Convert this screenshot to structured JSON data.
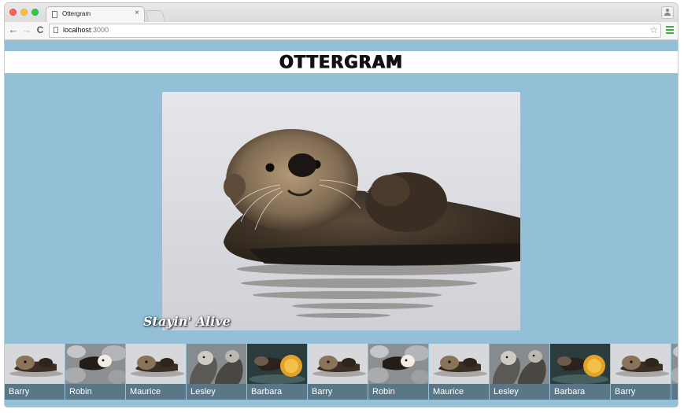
{
  "browser": {
    "tab_title": "Ottergram",
    "tab_close": "×",
    "url_host": "localhost",
    "url_port": ":3000",
    "back_glyph": "←",
    "forward_glyph": "→",
    "reload_glyph": "C",
    "star_glyph": "☆",
    "icons": [
      "page-icon",
      "star-icon",
      "menu-icon",
      "profile-icon"
    ]
  },
  "site": {
    "logo": "OTTERGRAM",
    "detail_title": "Stayin' Alive"
  },
  "colors": {
    "page_background": "#93c0d6",
    "thumb_label_background": "#5a7788",
    "menu_icon": "#3fae49"
  },
  "thumbnails": [
    {
      "label": "Barry",
      "kind": "floating"
    },
    {
      "label": "Robin",
      "kind": "rocks"
    },
    {
      "label": "Maurice",
      "kind": "floating"
    },
    {
      "label": "Lesley",
      "kind": "pair"
    },
    {
      "label": "Barbara",
      "kind": "orange"
    },
    {
      "label": "Barry",
      "kind": "floating"
    },
    {
      "label": "Robin",
      "kind": "rocks"
    },
    {
      "label": "Maurice",
      "kind": "floating"
    },
    {
      "label": "Lesley",
      "kind": "pair"
    },
    {
      "label": "Barbara",
      "kind": "orange"
    },
    {
      "label": "Barry",
      "kind": "floating"
    }
  ]
}
